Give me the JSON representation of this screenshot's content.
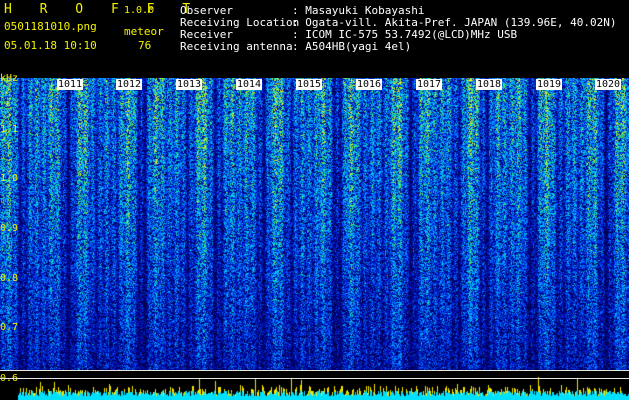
{
  "header": {
    "app_title": "H R O F F T",
    "version": "1.0.0",
    "filename": "0501181010.png",
    "type_label": "meteor",
    "datetime": "05.01.18 10:10",
    "count": "76"
  },
  "info": {
    "observer_label": "Observer",
    "observer_value": ": Masayuki Kobayashi",
    "location_label": "Receiving Location",
    "location_value": ": Ogata-vill. Akita-Pref. JAPAN (139.96E, 40.02N)",
    "receiver_label": "Receiver",
    "receiver_value": ": ICOM IC-575 53.7492(@LCD)MHz USB",
    "antenna_label": "Receiving antenna",
    "antenna_value": ": A504HB(yagi 4el)"
  },
  "axis": {
    "unit": "kHz",
    "ticks": [
      "1.1",
      "1.0",
      "0.9",
      "0.8",
      "0.7",
      "0.6"
    ]
  },
  "minute_markers": [
    "1011",
    "1012",
    "1013",
    "1014",
    "1015",
    "1016",
    "1017",
    "1018",
    "1019",
    "1020"
  ],
  "colors": {
    "text_yellow": "#f2f200",
    "text_white": "#ffffff",
    "background": "#000000",
    "noise_bar_cyan": "#00e0ff"
  }
}
